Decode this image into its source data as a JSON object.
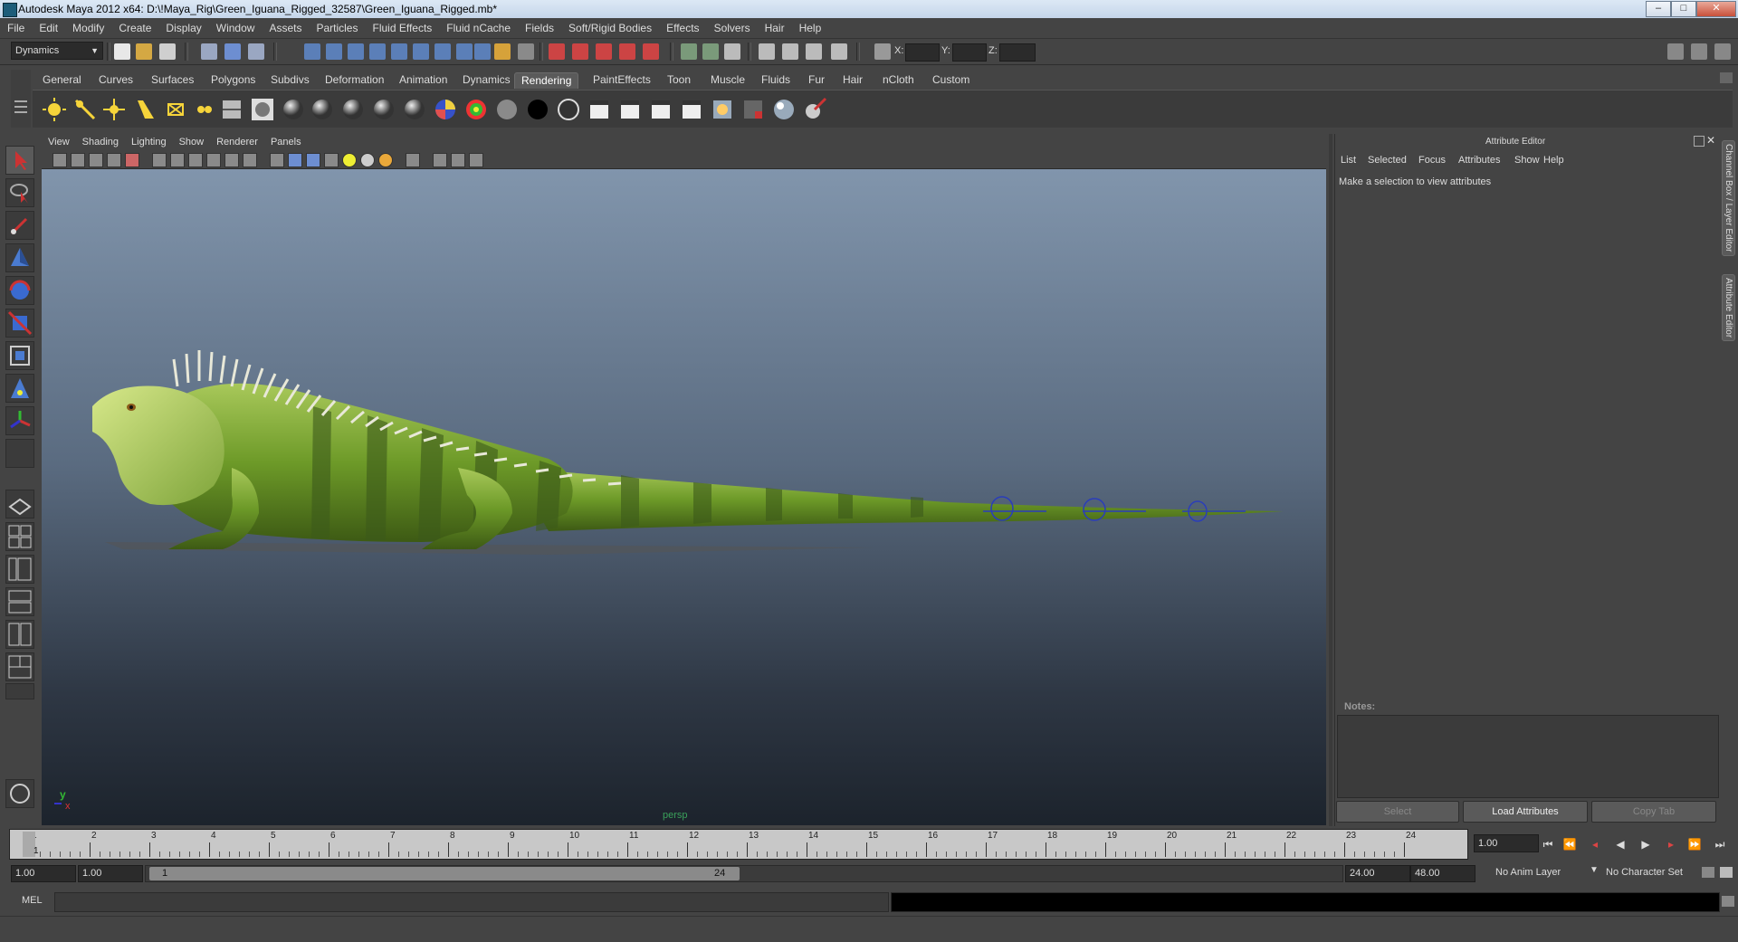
{
  "window": {
    "title": "Autodesk Maya 2012 x64: D:\\!Maya_Rig\\Green_Iguana_Rigged_32587\\Green_Iguana_Rigged.mb*",
    "minimize": "–",
    "maximize": "□",
    "close": "✕"
  },
  "menu": [
    "File",
    "Edit",
    "Modify",
    "Create",
    "Display",
    "Window",
    "Assets",
    "Particles",
    "Fluid Effects",
    "Fluid nCache",
    "Fields",
    "Soft/Rigid Bodies",
    "Effects",
    "Solvers",
    "Hair",
    "Help"
  ],
  "status": {
    "menuset": "Dynamics",
    "x_label": "X:",
    "y_label": "Y:",
    "z_label": "Z:"
  },
  "shelf": {
    "tabs": [
      "General",
      "Curves",
      "Surfaces",
      "Polygons",
      "Subdivs",
      "Deformation",
      "Animation",
      "Dynamics",
      "Rendering",
      "PaintEffects",
      "Toon",
      "Muscle",
      "Fluids",
      "Fur",
      "Hair",
      "nCloth",
      "Custom"
    ],
    "active_tab": "Rendering"
  },
  "panel": {
    "menus": [
      "View",
      "Shading",
      "Lighting",
      "Show",
      "Renderer",
      "Panels"
    ],
    "camera_label": "persp",
    "axis_y": "y",
    "axis_x": "x"
  },
  "attribute_editor": {
    "title": "Attribute Editor",
    "menus": [
      "List",
      "Selected",
      "Focus",
      "Attributes",
      "Show",
      "Help"
    ],
    "message": "Make a selection to view attributes",
    "notes_label": "Notes:",
    "buttons": {
      "select": "Select",
      "load": "Load Attributes",
      "copy": "Copy Tab"
    },
    "side_tabs": {
      "channel_box": "Channel Box / Layer Editor",
      "attribute_editor": "Attribute Editor"
    }
  },
  "timeline": {
    "ticks": [
      "1",
      "2",
      "3",
      "4",
      "5",
      "6",
      "7",
      "8",
      "9",
      "10",
      "11",
      "12",
      "13",
      "14",
      "15",
      "16",
      "17",
      "18",
      "19",
      "20",
      "21",
      "22",
      "23",
      "24"
    ],
    "current_frame_marker": "1",
    "current_time": "1.00"
  },
  "range": {
    "start_time": "1.00",
    "playback_start": "1.00",
    "slider_start": "1",
    "slider_end": "24",
    "playback_end": "24.00",
    "end_time": "48.00",
    "anim_layer": "No Anim Layer",
    "character_set": "No Character Set"
  },
  "command": {
    "label": "MEL"
  },
  "colors": {
    "accent_active_tab": "#5a5a5a",
    "iguana_green": "#6d9a28",
    "viewport_top": "#8195ac",
    "viewport_bottom": "#1c232c"
  }
}
